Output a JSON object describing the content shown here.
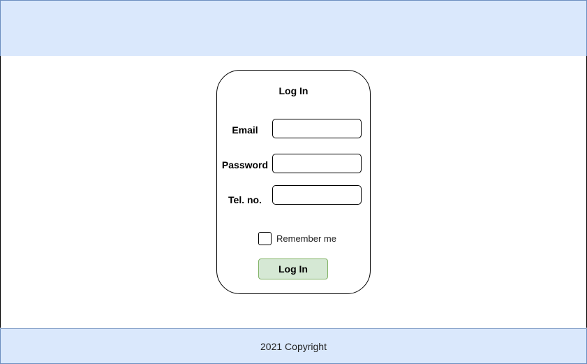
{
  "colors": {
    "header_bg": "#dae8fc",
    "header_border": "#6c8ebf",
    "button_bg": "#d5e8d4",
    "button_border": "#82b366"
  },
  "login": {
    "title": "Log In",
    "email_label": "Email",
    "email_value": "",
    "password_label": "Password",
    "password_value": "",
    "tel_label": "Tel. no.",
    "tel_value": "",
    "remember_label": "Remember me",
    "submit_label": "Log In"
  },
  "footer": {
    "copyright": "2021 Copyright"
  }
}
